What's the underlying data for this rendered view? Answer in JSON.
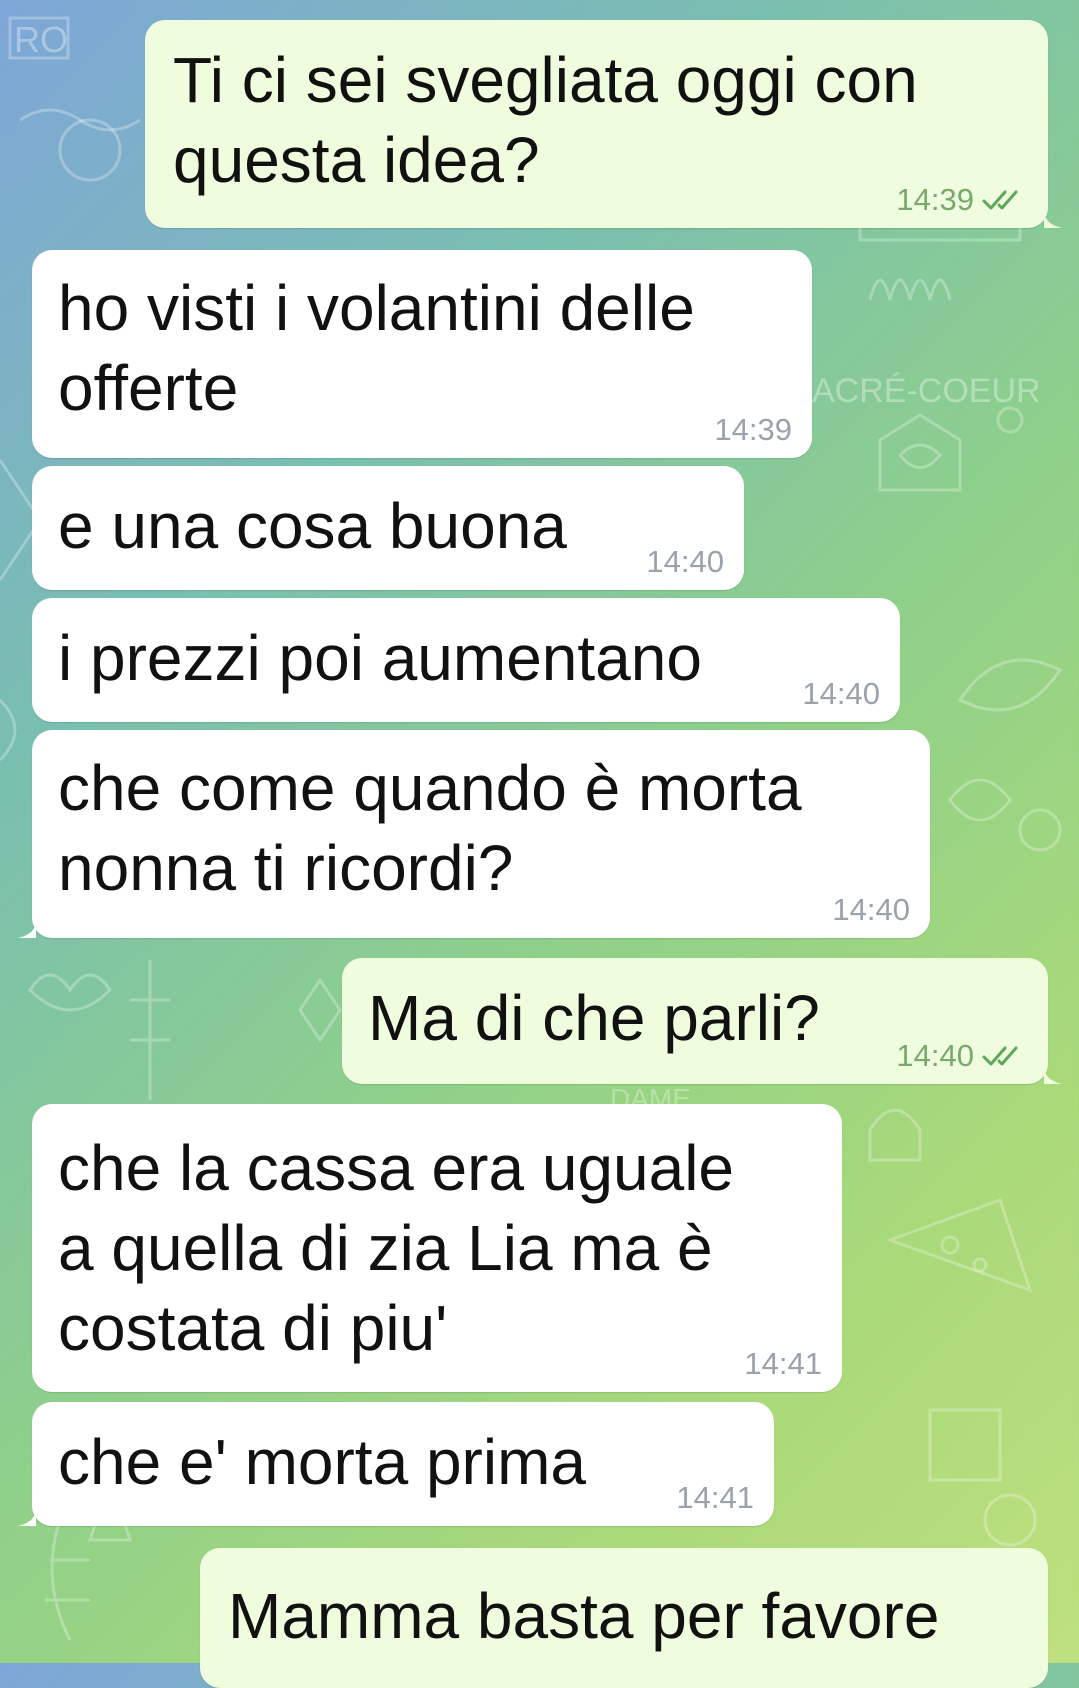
{
  "theme": {
    "incoming_bubble": "#ffffff",
    "outgoing_bubble": "#effdde",
    "check_color": "#5da75a"
  },
  "messages": [
    {
      "direction": "outgoing",
      "text": "Ti ci sei svegliata oggi con\nquesta idea?",
      "time": "14:39",
      "status_icon": "double-check-icon"
    },
    {
      "direction": "incoming",
      "text": "ho visti i volantini delle\nofferte",
      "time": "14:39"
    },
    {
      "direction": "incoming",
      "text": "e una cosa buona",
      "time": "14:40"
    },
    {
      "direction": "incoming",
      "text": "i prezzi poi aumentano",
      "time": "14:40"
    },
    {
      "direction": "incoming",
      "text": "che come quando è morta\nnonna ti ricordi?",
      "time": "14:40"
    },
    {
      "direction": "outgoing",
      "text": "Ma di che parli?",
      "time": "14:40",
      "status_icon": "double-check-icon"
    },
    {
      "direction": "incoming",
      "text": "che la cassa era uguale\na quella di zia Lia ma è\ncostata di piu'",
      "time": "14:41"
    },
    {
      "direction": "incoming",
      "text": "che e' morta prima",
      "time": "14:41"
    },
    {
      "direction": "outgoing",
      "text": "Mamma basta per favore",
      "time": ""
    }
  ],
  "wallpaper": {
    "labels": [
      "RO",
      "ACRÉ-COEUR",
      "DAME"
    ]
  }
}
